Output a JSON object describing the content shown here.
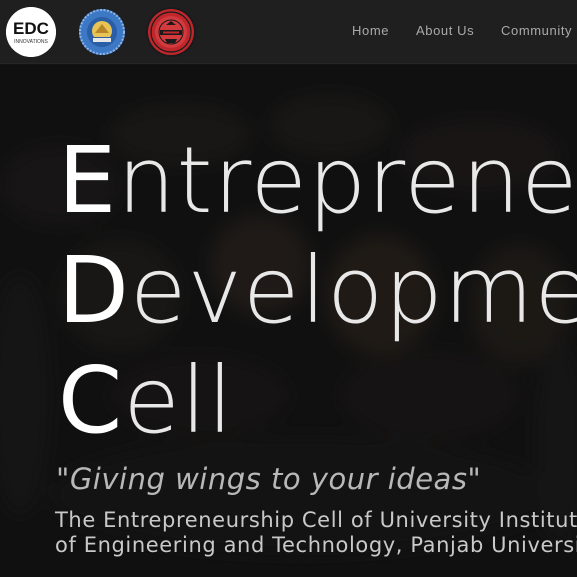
{
  "header": {
    "logos": [
      {
        "icon": "edc-logo-icon",
        "text": "EDC",
        "subtext": "INNOVATIONS"
      },
      {
        "icon": "university-seal-icon"
      },
      {
        "icon": "red-emblem-icon"
      }
    ],
    "nav": [
      {
        "label": "Home"
      },
      {
        "label": "About Us"
      },
      {
        "label": "Community"
      }
    ]
  },
  "hero": {
    "title_lines": [
      {
        "cap": "E",
        "rest": "ntrepreneurship"
      },
      {
        "cap": "D",
        "rest": "evelopment"
      },
      {
        "cap": "C",
        "rest": "ell"
      }
    ],
    "tagline": "\"Giving wings to your ideas\"",
    "description": "The Entrepreneurship Cell of University Institute of Engineering and Technology, Panjab University"
  },
  "colors": {
    "nav_background": "#1f1f1f",
    "nav_text": "#a9a9a9",
    "hero_background": "#151515",
    "title_text": "#f2f2f2",
    "tagline_text": "#b8b8b8",
    "emblem_red": "#c0272d"
  }
}
